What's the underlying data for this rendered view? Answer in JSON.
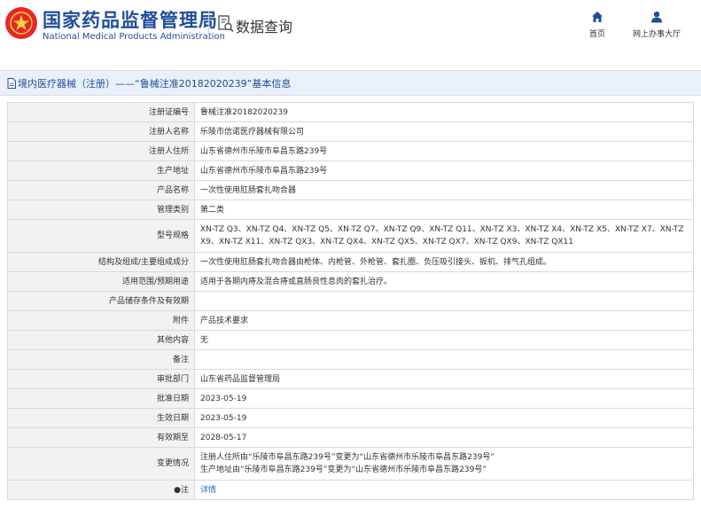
{
  "header": {
    "org_name_cn": "国家药品监督管理局",
    "org_name_en": "National Medical Products Administration",
    "query_title": "数据查询",
    "nav": [
      {
        "label": "首页",
        "icon": "home-icon"
      },
      {
        "label": "网上办事大厅",
        "icon": "user-icon"
      }
    ]
  },
  "breadcrumb": {
    "text": "境内医疗器械（注册）——“鲁械注准20182020239”基本信息"
  },
  "record": [
    {
      "label": "注册证编号",
      "value": "鲁械注准20182020239"
    },
    {
      "label": "注册人名称",
      "value": "乐陵市信诺医疗器械有限公司"
    },
    {
      "label": "注册人住所",
      "value": "山东省德州市乐陵市阜昌东路239号"
    },
    {
      "label": "生产地址",
      "value": "山东省德州市乐陵市阜昌东路239号"
    },
    {
      "label": "产品名称",
      "value": "一次性使用肛肠套扎吻合器"
    },
    {
      "label": "管理类别",
      "value": "第二类"
    },
    {
      "label": "型号规格",
      "value": "XN-TZ Q3、XN-TZ Q4、XN-TZ Q5、XN-TZ Q7、XN-TZ Q9、XN-TZ Q11、XN-TZ X3、XN-TZ X4、XN-TZ X5、XN-TZ X7、XN-TZ X9、XN-TZ X11、XN-TZ QX3、XN-TZ QX4、XN-TZ QX5、XN-TZ QX7、XN-TZ QX9、XN-TZ QX11"
    },
    {
      "label": "结构及组成/主要组成成分",
      "value": "一次性使用肛肠套扎吻合器由枪体、内枪管、外枪管、套扎圈、负压吸引接头、扳机、排气孔组成。"
    },
    {
      "label": "适用范围/预期用途",
      "value": "适用于各期内痔及混合痔或直肠良性息肉的套扎治疗。"
    },
    {
      "label": "产品储存条件及有效期",
      "value": ""
    },
    {
      "label": "附件",
      "value": "产品技术要求"
    },
    {
      "label": "其他内容",
      "value": "无"
    },
    {
      "label": "备注",
      "value": ""
    },
    {
      "label": "审批部门",
      "value": "山东省药品监督管理局"
    },
    {
      "label": "批准日期",
      "value": "2023-05-19"
    },
    {
      "label": "生效日期",
      "value": "2023-05-19"
    },
    {
      "label": "有效期至",
      "value": "2028-05-17"
    },
    {
      "label": "变更情况",
      "value": "注册人住所由“乐陵市阜昌东路239号”变更为“山东省德州市乐陵市阜昌东路239号”",
      "value2": "生产地址由“乐陵市阜昌东路239号”变更为“山东省德州市乐陵市阜昌东路239号”"
    },
    {
      "label": "注",
      "value": "详情"
    }
  ],
  "colors": {
    "brand_blue": "#1f4e9c",
    "logo_red": "#e8262a",
    "crumb_bg": "#eaf0f8",
    "link": "#1f6fc5"
  }
}
